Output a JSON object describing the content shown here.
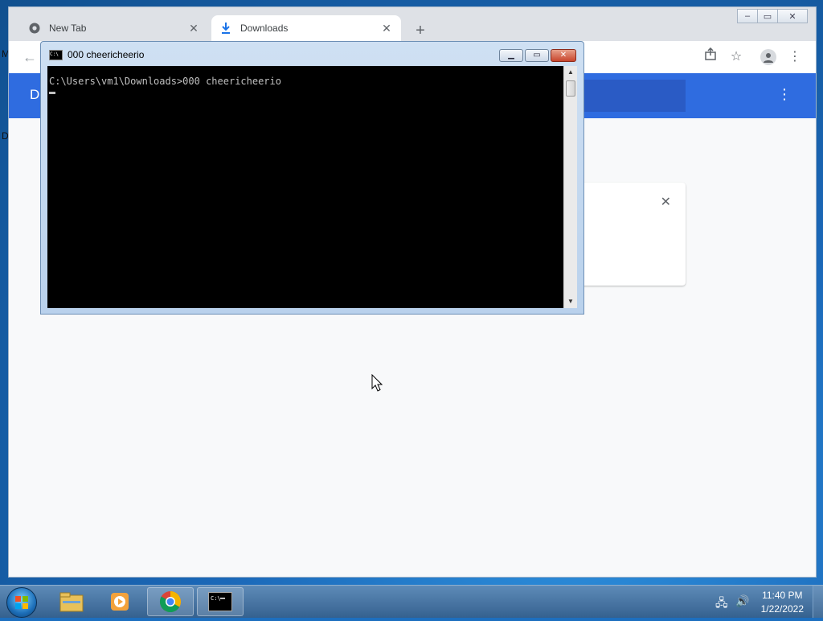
{
  "desktop": {
    "edge_letters": [
      "M",
      "D"
    ]
  },
  "browser": {
    "tabs": [
      {
        "label": "New Tab",
        "icon": "chrome-icon",
        "active": false
      },
      {
        "label": "Downloads",
        "icon": "download-icon",
        "active": true
      }
    ],
    "new_tab_symbol": "+",
    "back_symbol": "←",
    "header_letter": "D",
    "window_controls": [
      "minimize",
      "maximize",
      "close"
    ]
  },
  "console": {
    "title": "000  cheericheerio",
    "icon_text": "C:\\",
    "command_line": "C:\\Users\\vm1\\Downloads>000 cheericheerio"
  },
  "taskbar": {
    "apps": [
      "file-explorer",
      "media-player",
      "chrome",
      "command-prompt"
    ],
    "time": "11:40 PM",
    "date": "1/22/2022"
  }
}
